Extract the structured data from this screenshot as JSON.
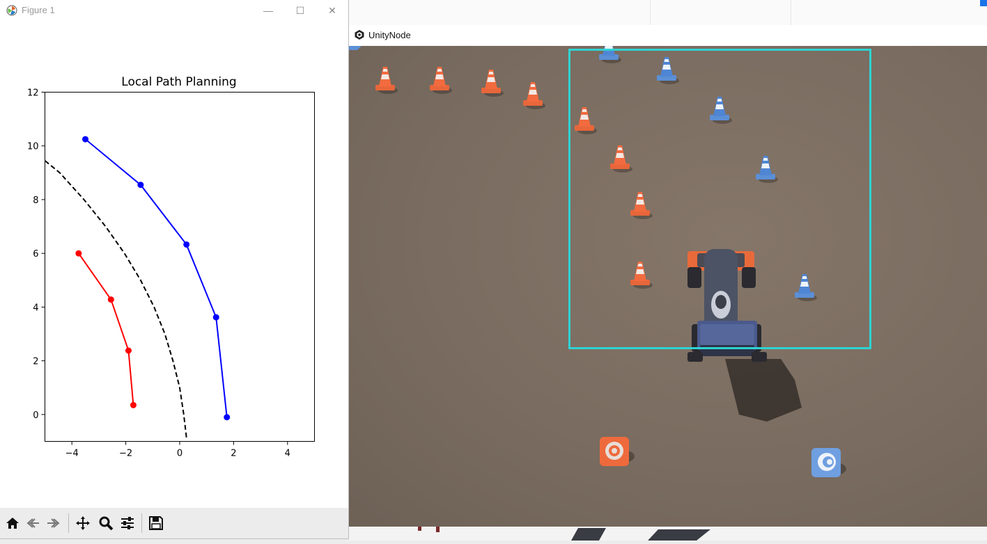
{
  "figure_window": {
    "title": "Figure 1",
    "controls": {
      "minimize": "—",
      "maximize": "☐",
      "close": "✕"
    },
    "toolbar": [
      {
        "name": "home-icon",
        "label": "Home"
      },
      {
        "name": "back-icon",
        "label": "Back"
      },
      {
        "name": "forward-icon",
        "label": "Forward"
      },
      {
        "name": "pan-icon",
        "label": "Pan"
      },
      {
        "name": "zoom-icon",
        "label": "Zoom"
      },
      {
        "name": "configure-subplots-icon",
        "label": "Configure subplots"
      },
      {
        "name": "save-icon",
        "label": "Save"
      }
    ]
  },
  "unity_window": {
    "title": "UnityNode",
    "detection_box_color": "#2ed3d3"
  },
  "chart_data": {
    "type": "line",
    "title": "Local Path Planning",
    "xlabel": "",
    "ylabel": "",
    "xlim": [
      -5,
      5
    ],
    "ylim": [
      -1,
      12
    ],
    "xticks": [
      "−4",
      "−2",
      "0",
      "2",
      "4"
    ],
    "yticks": [
      "0",
      "2",
      "4",
      "6",
      "8",
      "10",
      "12"
    ],
    "series": [
      {
        "color": "#0000ff",
        "style": "line-markers",
        "points": [
          [
            1.75,
            -0.1
          ],
          [
            1.35,
            3.62
          ],
          [
            0.25,
            6.33
          ],
          [
            -1.45,
            8.55
          ],
          [
            -3.5,
            10.25
          ]
        ]
      },
      {
        "color": "#ff0000",
        "style": "line-markers",
        "points": [
          [
            -1.72,
            0.35
          ],
          [
            -1.9,
            2.38
          ],
          [
            -2.55,
            4.28
          ],
          [
            -3.75,
            6.0
          ]
        ]
      },
      {
        "color": "#000000",
        "style": "dashed",
        "points": [
          [
            0.25,
            -0.85
          ],
          [
            0.15,
            0.0
          ],
          [
            0.0,
            1.0
          ],
          [
            -0.25,
            2.0
          ],
          [
            -0.55,
            3.0
          ],
          [
            -0.95,
            4.0
          ],
          [
            -1.45,
            5.0
          ],
          [
            -2.05,
            6.0
          ],
          [
            -2.75,
            7.0
          ],
          [
            -3.55,
            8.0
          ],
          [
            -4.45,
            9.0
          ],
          [
            -5.0,
            9.45
          ]
        ]
      }
    ]
  }
}
